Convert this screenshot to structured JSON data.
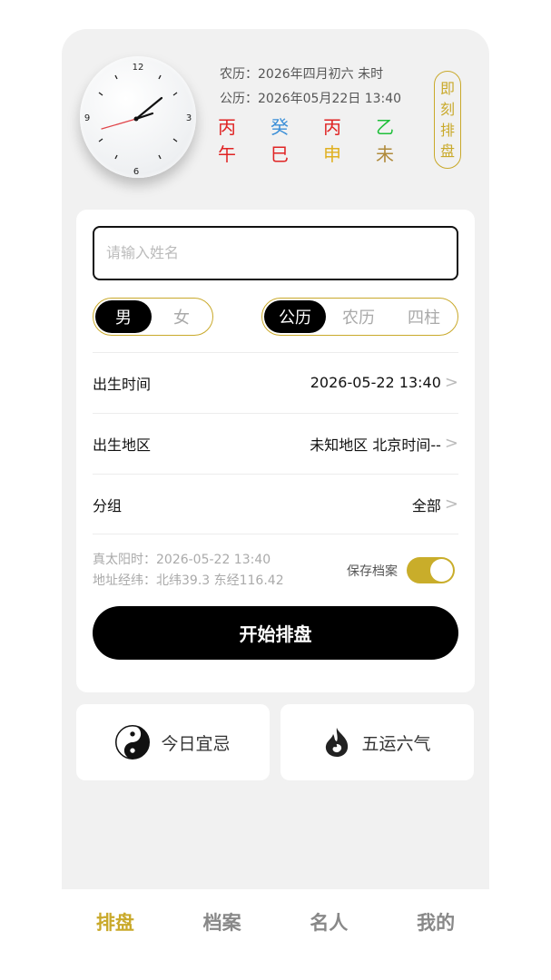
{
  "header": {
    "lunar_line": "农历：2026年四月初六  未时",
    "solar_line": "公历：2026年05月22日 13:40",
    "ganzhi_top": [
      {
        "text": "丙",
        "color": "#e02424"
      },
      {
        "text": "癸",
        "color": "#3b8fd8"
      },
      {
        "text": "丙",
        "color": "#e02424"
      },
      {
        "text": "乙",
        "color": "#1fbf3a"
      }
    ],
    "ganzhi_bottom": [
      {
        "text": "午",
        "color": "#e02424"
      },
      {
        "text": "巳",
        "color": "#e02424"
      },
      {
        "text": "申",
        "color": "#e0b020"
      },
      {
        "text": "未",
        "color": "#b08a3a"
      }
    ],
    "now_button": [
      "即",
      "刻",
      "排",
      "盘"
    ],
    "clock_numbers": {
      "n12": "12",
      "n3": "3",
      "n6": "6",
      "n9": "9"
    }
  },
  "form": {
    "name_placeholder": "请输入姓名",
    "gender": {
      "male": "男",
      "female": "女",
      "selected": "男"
    },
    "calendar": {
      "options": [
        "公历",
        "农历",
        "四柱"
      ],
      "selected": "公历"
    },
    "rows": [
      {
        "label": "出生时间",
        "value": "2026-05-22 13:40"
      },
      {
        "label": "出生地区",
        "value": "未知地区 北京时间--"
      },
      {
        "label": "分组",
        "value": "全部"
      }
    ],
    "chevron": ">",
    "solar_time": "真太阳时：2026-05-22 13:40",
    "coords": "地址经纬：北纬39.3 东经116.42",
    "save_label": "保存档案",
    "save_on": true,
    "start_button": "开始排盘"
  },
  "tiles": [
    {
      "label": "今日宜忌",
      "icon": "yin-yang-icon"
    },
    {
      "label": "五运六气",
      "icon": "flame-swirl-icon"
    }
  ],
  "tabbar": {
    "tabs": [
      "排盘",
      "档案",
      "名人",
      "我的"
    ],
    "active": "排盘",
    "accent": "#c9a92a"
  }
}
